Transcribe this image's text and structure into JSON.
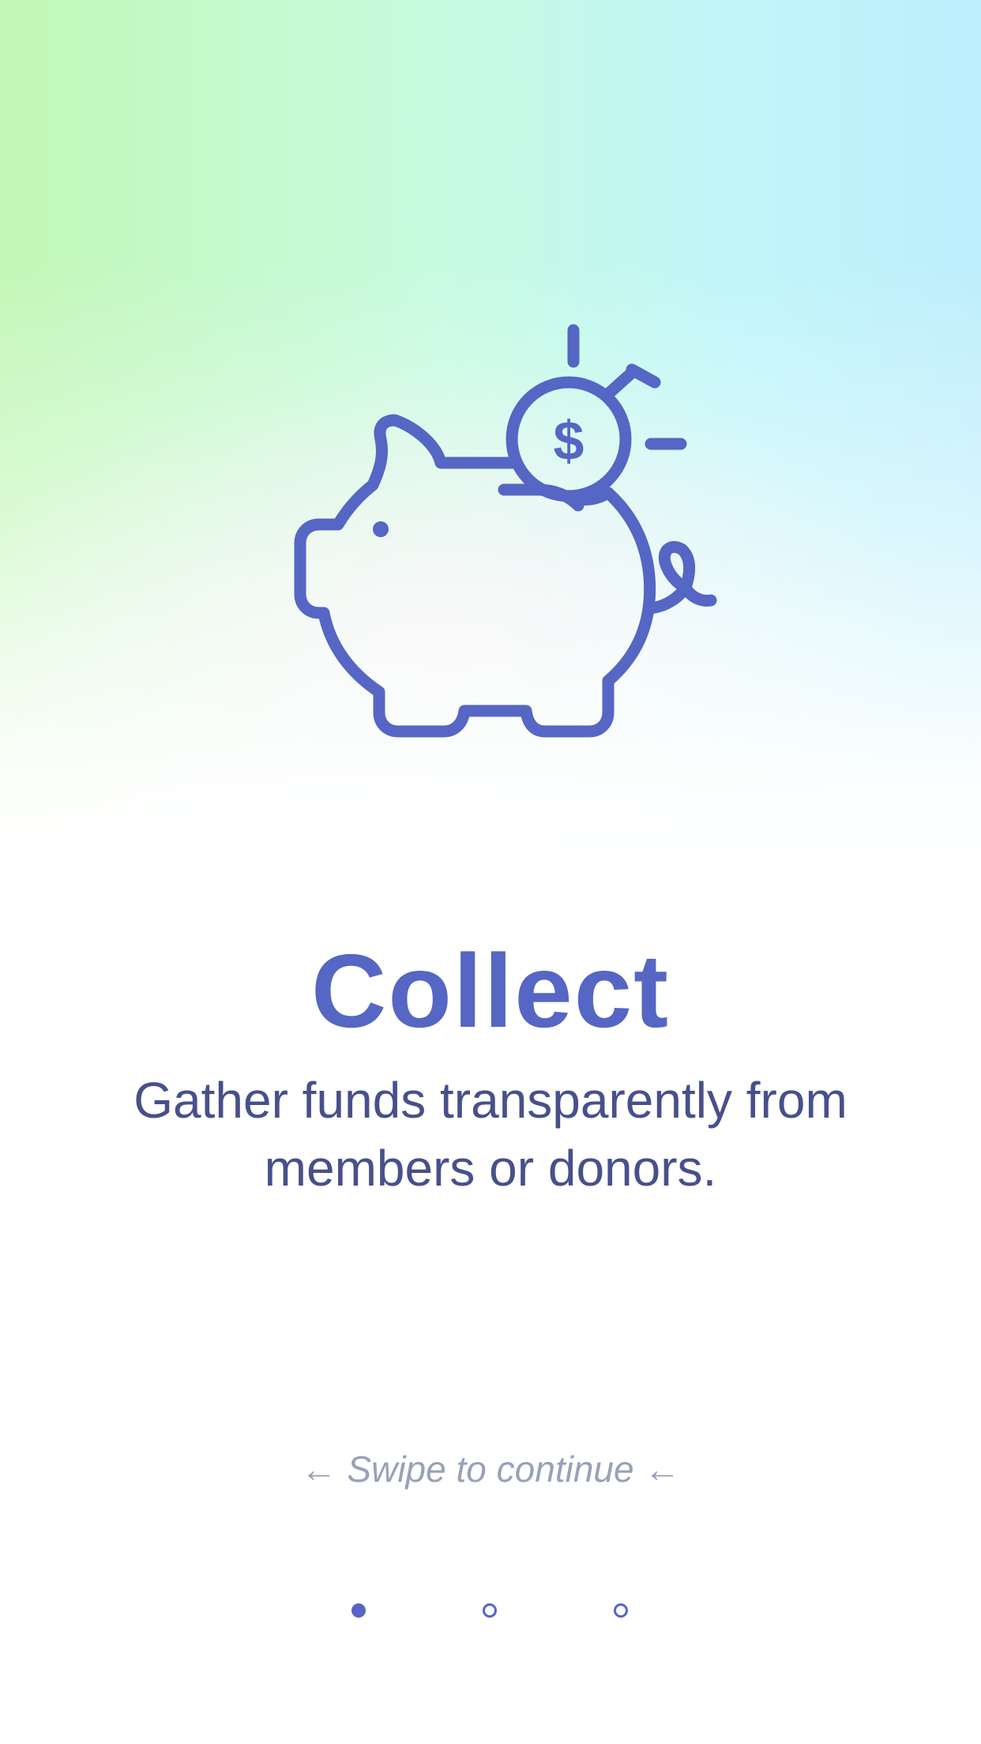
{
  "theme": {
    "accent": "#5566c4",
    "title_color": "#5566c4",
    "body_text_color": "#47508a",
    "hint_color": "#9aa0b8",
    "background_top_left": "#c2f7b6",
    "background_top_right": "#bdeefc",
    "background_bottom": "#ffffff"
  },
  "onboarding": {
    "icon": "piggy-bank-coin-icon",
    "title": "Collect",
    "subtitle": "Gather funds transparently from members or donors.",
    "swipe_hint": "← Swipe to continue ←"
  },
  "pager": {
    "page_count": 3,
    "active_index": 0
  }
}
